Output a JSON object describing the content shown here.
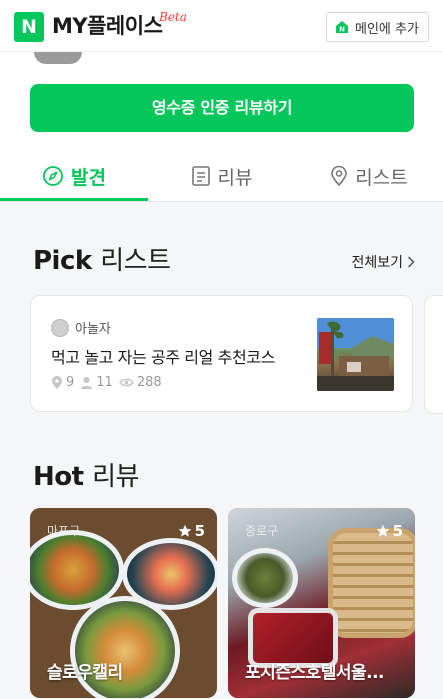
{
  "header": {
    "logo_letter": "N",
    "brand": "MY플레이스",
    "beta": "Beta",
    "home_button_label": "메인에 추가"
  },
  "receipt_button_label": "영수증 인증 리뷰하기",
  "tabs": [
    {
      "label": "발견",
      "icon": "compass-icon",
      "active": true
    },
    {
      "label": "리뷰",
      "icon": "document-icon",
      "active": false
    },
    {
      "label": "리스트",
      "icon": "location-pin-icon",
      "active": false
    }
  ],
  "accent_color": "#03c75a",
  "pick": {
    "title_en": "Pick",
    "title_ko": "리스트",
    "view_all": "전체보기",
    "cards": [
      {
        "author": "아놀자",
        "title": "먹고 놀고 자는 공주 리얼 추천코스",
        "places": "9",
        "followers": "11",
        "views": "288"
      }
    ]
  },
  "hot": {
    "title_en": "Hot",
    "title_ko": "리뷰",
    "cards": [
      {
        "area": "마포구",
        "rating": "5",
        "name": "슬로우캘리"
      },
      {
        "area": "중로구",
        "rating": "5",
        "name": "포시즌스호텔서울..."
      }
    ]
  }
}
